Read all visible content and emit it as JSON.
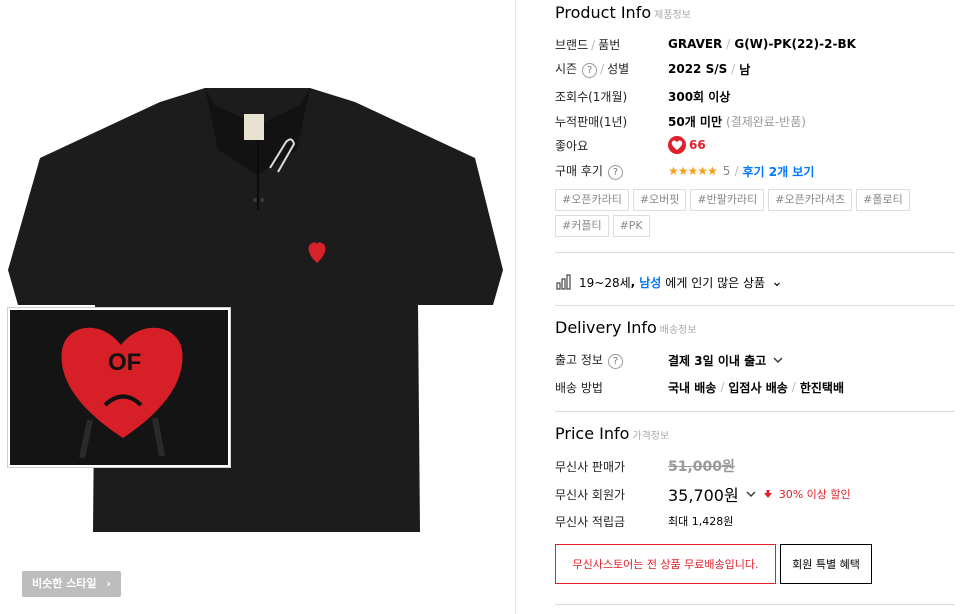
{
  "left": {
    "similar_style_label": "비슷한 스타일",
    "similar_style_chevron": "›",
    "zoom_patch_text": "OF"
  },
  "product_info": {
    "title": "Product Info",
    "subtitle": "제품정보",
    "brand_label": "브랜드",
    "part_label": "품번",
    "brand": "GRAVER",
    "part_no": "G(W)-PK(22)-2-BK",
    "season_label": "시즌",
    "gender_label": "성별",
    "season": "2022 S/S",
    "gender": "남",
    "views_label": "조회수(1개월)",
    "views": "300회 이상",
    "sales_label": "누적판매(1년)",
    "sales": "50개 미만",
    "sales_note": "(결제완료-반품)",
    "likes_label": "좋아요",
    "likes": "66",
    "review_label": "구매 후기",
    "review_stars": "★★★★★",
    "review_score": "5",
    "review_link": "후기 2개 보기",
    "tags": [
      "#오픈카라티",
      "#오버핏",
      "#반팔카라티",
      "#오픈카라셔츠",
      "#폴로티",
      "#커플티",
      "#PK"
    ],
    "popular_age": "19~28세",
    "popular_sep": ",",
    "popular_gender": "남성",
    "popular_suffix": "에게 인기 많은 상품",
    "popular_chevron": "⌄"
  },
  "delivery_info": {
    "title": "Delivery Info",
    "subtitle": "배송정보",
    "ship_label": "출고 정보",
    "ship_value": "결제 3일 이내 출고",
    "method_label": "배송 방법",
    "method_1": "국내 배송",
    "method_2": "입점사 배송",
    "method_3": "한진택배"
  },
  "price_info": {
    "title": "Price Info",
    "subtitle": "가격정보",
    "sale_label": "무신사 판매가",
    "sale_price": "51,000원",
    "member_label": "무신사 회원가",
    "member_price": "35,700원",
    "discount_text": "30% 이상 할인",
    "points_label": "무신사 적립금",
    "points_value": "최대 1,428원",
    "free_shipping": "무신사스토어는 전 상품 무료배송입니다.",
    "member_benefit": "회원 특별 혜택"
  },
  "colors": {
    "accent_red": "#e0202b",
    "link_blue": "#0078ff",
    "star_orange": "#f59f1b"
  }
}
